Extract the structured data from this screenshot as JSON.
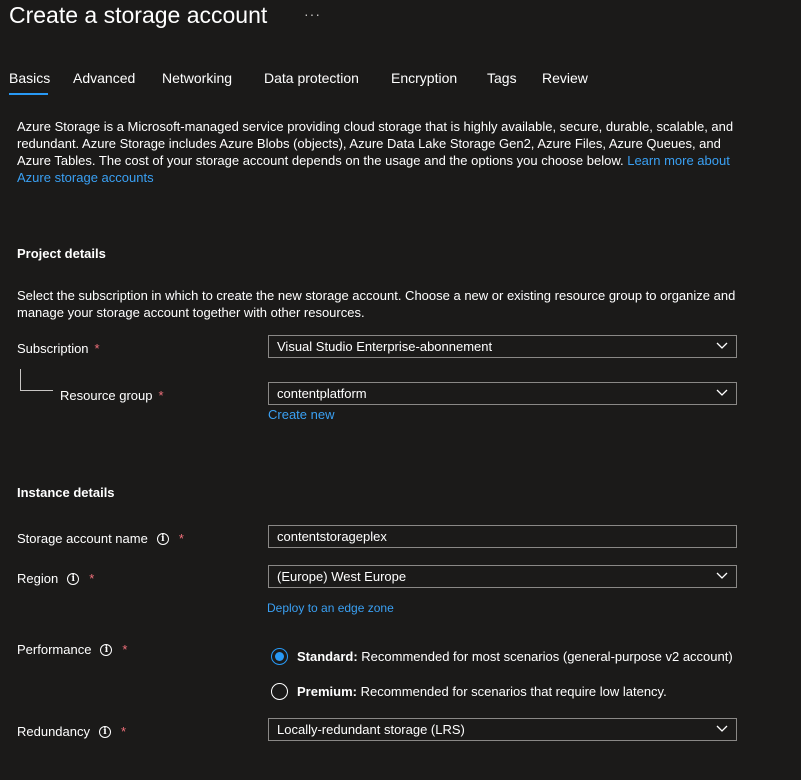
{
  "header": {
    "title": "Create a storage account",
    "more": "···"
  },
  "tabs": [
    {
      "label": "Basics"
    },
    {
      "label": "Advanced"
    },
    {
      "label": "Networking"
    },
    {
      "label": "Data protection"
    },
    {
      "label": "Encryption"
    },
    {
      "label": "Tags"
    },
    {
      "label": "Review"
    }
  ],
  "intro": {
    "text": "Azure Storage is a Microsoft-managed service providing cloud storage that is highly available, secure, durable, scalable, and redundant. Azure Storage includes Azure Blobs (objects), Azure Data Lake Storage Gen2, Azure Files, Azure Queues, and Azure Tables. The cost of your storage account depends on the usage and the options you choose below. ",
    "link": "Learn more about Azure storage accounts"
  },
  "project": {
    "title": "Project details",
    "description": "Select the subscription in which to create the new storage account. Choose a new or existing resource group to organize and manage your storage account together with other resources.",
    "subscription_label": "Subscription",
    "subscription_value": "Visual Studio Enterprise-abonnement",
    "resource_group_label": "Resource group",
    "resource_group_value": "contentplatform",
    "create_new": "Create new"
  },
  "instance": {
    "title": "Instance details",
    "name_label": "Storage account name",
    "name_value": "contentstorageplex",
    "region_label": "Region",
    "region_value": "(Europe) West Europe",
    "edge_zone_link": "Deploy to an edge zone",
    "performance_label": "Performance",
    "standard_bold": "Standard:",
    "standard_text": " Recommended for most scenarios (general-purpose v2 account)",
    "premium_bold": "Premium:",
    "premium_text": " Recommended for scenarios that require low latency.",
    "redundancy_label": "Redundancy",
    "redundancy_value": "Locally-redundant storage (LRS)"
  },
  "required_mark": "*",
  "info_glyph": "i",
  "colors": {
    "accent": "#2899f5",
    "link": "#3aa0f3",
    "required": "#f1707b",
    "background": "#1b1a19"
  }
}
